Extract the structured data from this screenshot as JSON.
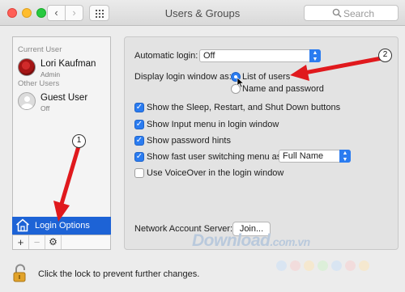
{
  "window": {
    "title": "Users & Groups"
  },
  "toolbar": {
    "search_placeholder": "Search"
  },
  "sidebar": {
    "current_user_header": "Current User",
    "current_user": {
      "name": "Lori Kaufman",
      "role": "Admin"
    },
    "other_users_header": "Other Users",
    "other_users": [
      {
        "name": "Guest User",
        "role": "Off"
      }
    ],
    "selected_item": "Login Options",
    "add_label": "+",
    "remove_label": "−",
    "gear_label": "⚙"
  },
  "settings": {
    "automatic_login_label": "Automatic login:",
    "automatic_login_value": "Off",
    "display_login_label": "Display login window as:",
    "display_options": [
      "List of users",
      "Name and password"
    ],
    "display_selected": "List of users",
    "checkboxes": [
      {
        "label": "Show the Sleep, Restart, and Shut Down buttons",
        "checked": true
      },
      {
        "label": "Show Input menu in login window",
        "checked": true
      },
      {
        "label": "Show password hints",
        "checked": true
      },
      {
        "label": "Show fast user switching menu as",
        "checked": true
      },
      {
        "label": "Use VoiceOver in the login window",
        "checked": false
      }
    ],
    "fast_switch_value": "Full Name",
    "network_server_label": "Network Account Server:",
    "join_button": "Join..."
  },
  "footer": {
    "lock_text": "Click the lock to prevent further changes."
  },
  "watermark": {
    "main": "Download",
    "domain": ".com.vn"
  },
  "annotations": {
    "badge_1": "1",
    "badge_2": "2"
  },
  "colors": {
    "accent": "#2b7cf0",
    "selection": "#1d63d6",
    "arrow": "#e0191d"
  }
}
